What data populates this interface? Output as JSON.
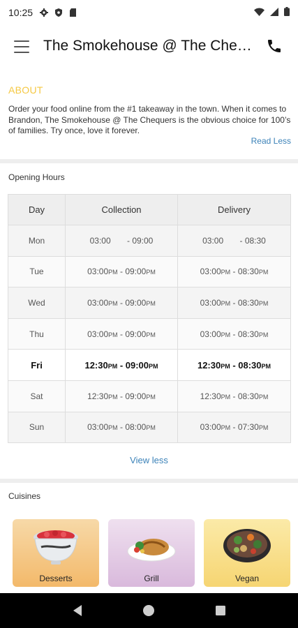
{
  "status_bar": {
    "time": "10:25",
    "left_icons": [
      "gear-icon",
      "shield-icon",
      "sim-card-icon"
    ],
    "right_icons": [
      "wifi-icon",
      "signal-icon",
      "battery-icon"
    ]
  },
  "app_bar": {
    "title": "The Smokehouse @ The Chequers",
    "menu_icon": "hamburger-menu-icon",
    "call_icon": "phone-icon"
  },
  "about": {
    "heading": "ABOUT",
    "text": "Order your food online from the #1 takeaway in the town. When it comes to Brandon, The Smokehouse @ The Chequers is the obvious choice for 100’s of families. Try once, love it forever.",
    "read_less": "Read Less"
  },
  "opening_hours": {
    "title": "Opening Hours",
    "headers": [
      "Day",
      "Collection",
      "Delivery"
    ],
    "rows": [
      {
        "day": "Mon",
        "collection": "03:00       - 09:00",
        "delivery": "03:00       - 08:30",
        "pm": false
      },
      {
        "day": "Tue",
        "collection": [
          "03:00",
          "PM",
          " - 09:00",
          "PM"
        ],
        "delivery": [
          "03:00",
          "PM",
          " - 08:30",
          "PM"
        ],
        "pm": true
      },
      {
        "day": "Wed",
        "collection": [
          "03:00",
          "PM",
          " - 09:00",
          "PM"
        ],
        "delivery": [
          "03:00",
          "PM",
          " - 08:30",
          "PM"
        ],
        "pm": true
      },
      {
        "day": "Thu",
        "collection": [
          "03:00",
          "PM",
          " - 09:00",
          "PM"
        ],
        "delivery": [
          "03:00",
          "PM",
          " - 08:30",
          "PM"
        ],
        "pm": true
      },
      {
        "day": "Fri",
        "collection": [
          "12:30",
          "PM",
          " - 09:00",
          "PM"
        ],
        "delivery": [
          "12:30",
          "PM",
          " - 08:30",
          "PM"
        ],
        "pm": true,
        "today": true
      },
      {
        "day": "Sat",
        "collection": [
          "12:30",
          "PM",
          " - 09:00",
          "PM"
        ],
        "delivery": [
          "12:30",
          "PM",
          " - 08:30",
          "PM"
        ],
        "pm": true
      },
      {
        "day": "Sun",
        "collection": [
          "03:00",
          "PM",
          " - 08:00",
          "PM"
        ],
        "delivery": [
          "03:00",
          "PM",
          " - 07:30",
          "PM"
        ],
        "pm": true
      }
    ],
    "view_less": "View less"
  },
  "cuisines": {
    "title": "Cuisines",
    "items": [
      {
        "label": "Desserts",
        "color_top": "#f7d9a8",
        "color_bottom": "#f3b96a"
      },
      {
        "label": "Grill",
        "color_top": "#efe0ef",
        "color_bottom": "#d9b9dc"
      },
      {
        "label": "Vegan",
        "color_top": "#fbeaa8",
        "color_bottom": "#f6d572"
      }
    ]
  },
  "nav_bar": {
    "icons": [
      "back-icon",
      "home-icon",
      "recents-icon"
    ]
  },
  "colors": {
    "accent_yellow": "#f5c842",
    "link_blue": "#3b82b8"
  }
}
